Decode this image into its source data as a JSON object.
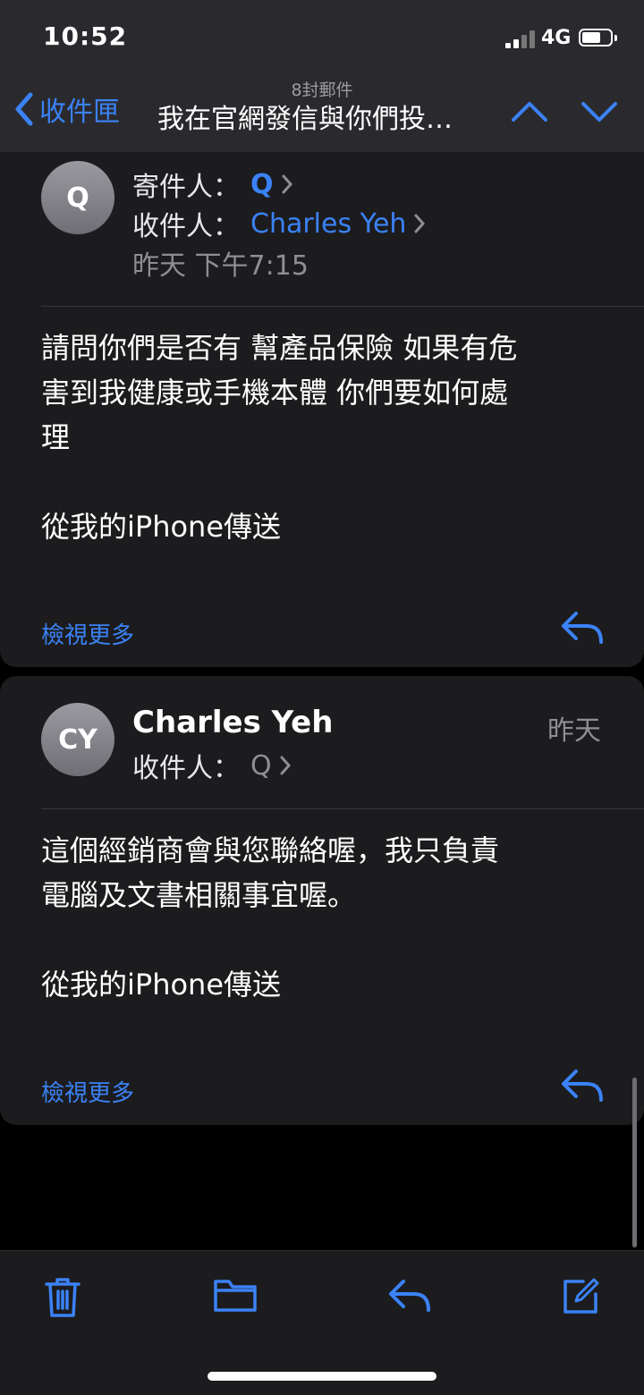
{
  "status_bar": {
    "time": "10:52",
    "network": "4G"
  },
  "nav": {
    "back_label": "收件匣",
    "message_count": "8封郵件",
    "subject": "我在官網發信與你們投…"
  },
  "messages": [
    {
      "avatar": "Q",
      "from_label": "寄件人：",
      "from": "Q",
      "to_label": "收件人：",
      "to": "Charles Yeh",
      "date": "昨天 下午7:15",
      "body": [
        "請問你們是否有 幫產品保險 如果有危",
        "害到我健康或手機本體 你們要如何處",
        "理",
        "",
        "從我的iPhone傳送"
      ],
      "see_more": "檢視更多"
    },
    {
      "avatar": "CY",
      "sender": "Charles Yeh",
      "date": "昨天",
      "to_label": "收件人：",
      "to": "Q",
      "body": [
        "這個經銷商會與您聯絡喔，我只負責",
        "電腦及文書相關事宜喔。",
        "",
        "從我的iPhone傳送"
      ],
      "see_more": "檢視更多"
    }
  ],
  "icons": {
    "accent": "#3b82f6",
    "toolbar": [
      "trash-icon",
      "folder-icon",
      "reply-icon",
      "compose-icon"
    ]
  }
}
